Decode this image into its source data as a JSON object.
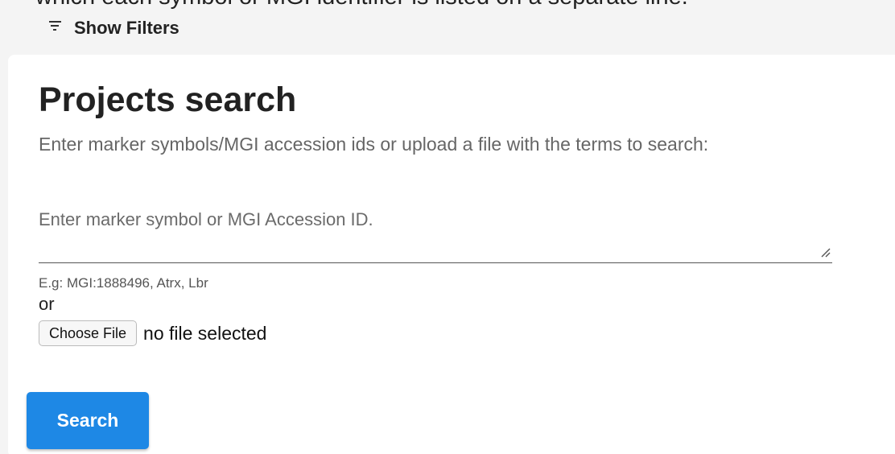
{
  "header": {
    "cut_off_text": "which each symbol or MGI identifier is listed on a separate line."
  },
  "filters": {
    "toggle_label": "Show Filters",
    "icon": "filter-list-icon"
  },
  "search_panel": {
    "title": "Projects search",
    "subtitle": "Enter marker symbols/MGI accession ids or upload a file with the terms to search:",
    "input": {
      "value": "",
      "placeholder": "Enter marker symbol or MGI Accession ID."
    },
    "hint": "E.g: MGI:1888496, Atrx, Lbr",
    "or_text": "or",
    "file": {
      "button_label": "Choose File",
      "status": "no file selected"
    },
    "search_button_label": "Search"
  },
  "colors": {
    "accent": "#1e88e5",
    "page_background": "#f4f4f4",
    "card_background": "#ffffff"
  }
}
